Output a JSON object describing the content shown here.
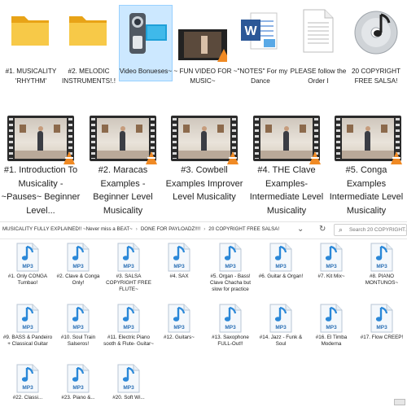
{
  "top_items": [
    {
      "label": "#1. MUSICALITY 'RHYTHM'",
      "icon": "folder-icon"
    },
    {
      "label": "#2. MELODIC INSTRUMENTS!.!",
      "icon": "folder-icon"
    },
    {
      "label": "Video Bonueses~",
      "icon": "camcorder-icon"
    },
    {
      "label": "~ FUN VIDEO FOR MUSIC~",
      "icon": "video-file-icon"
    },
    {
      "label": "~\"NOTES\" For my Dance",
      "icon": "word-document-icon"
    },
    {
      "label": "PLEASE follow the Order I",
      "icon": "text-document-icon"
    },
    {
      "label": "20 COPYRIGHT FREE SALSA!",
      "icon": "music-disc-icon"
    }
  ],
  "videos": [
    {
      "label": "#1. Introduction To Musicality - ~Pauses~ Beginner Level..."
    },
    {
      "label": "#2. Maracas Examples - Beginner Level Musicality"
    },
    {
      "label": "#3. Cowbell Examples Improver Level Musicality"
    },
    {
      "label": "#4. THE Clave Examples- Intermediate Level Musicality"
    },
    {
      "label": "#5. Conga Examples Intermediate Level Musicality"
    }
  ],
  "address_bar": {
    "crumbs": [
      "MUSICALITY FULLY EXPLAINED!! ~Never miss a BEAT~",
      "DONE FOR PAYLOADZ!!!!",
      "20 COPYRIGHT FREE SALSA!"
    ],
    "search_placeholder": "Search 20 COPYRIGHT..."
  },
  "mp3_files": [
    {
      "name": "#1. Only CONGA Tumbao!"
    },
    {
      "name": "#2. Clave & Conga Only!"
    },
    {
      "name": "#3. SALSA COPYRIGHT FREE FLUTE~"
    },
    {
      "name": "#4. SAX"
    },
    {
      "name": "#5. Organ - Bass! Clave Chacha but slow for practice"
    },
    {
      "name": "#6. Guitar & Organ!"
    },
    {
      "name": "#7. Kit Mix~"
    },
    {
      "name": "#8. PIANO MONTUNOS~"
    },
    {
      "name": "#9. BASS & Pandeiro + Classical Guitar"
    },
    {
      "name": "#10. Soul Train Salseros!"
    },
    {
      "name": "#11. Electric Piano sooth & Flute- Guitar~"
    },
    {
      "name": "#12. Guitars~"
    },
    {
      "name": "#13. Saxophone FULL-Out!!"
    },
    {
      "name": "#14. Jazz - Funk & Soul"
    },
    {
      "name": "#16. El Timba Moderna"
    },
    {
      "name": "#17. Flow CREEP!"
    },
    {
      "name": "#22. Classi..."
    },
    {
      "name": "#23. Piano &..."
    },
    {
      "name": "#20. Soft Wi..."
    }
  ],
  "file_type_badge": "MP3",
  "colors": {
    "folder": "#f7c948",
    "selection": "#cce8ff",
    "mp3_note": "#2b88d8",
    "word_blue": "#2b5797",
    "vlc_orange": "#f08a24"
  }
}
